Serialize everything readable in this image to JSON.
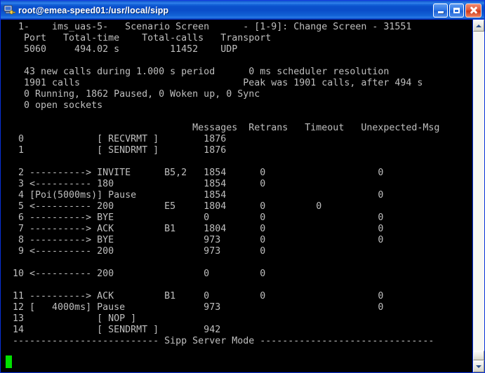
{
  "window": {
    "title": "root@emea-speed01:/usr/local/sipp",
    "icon": "putty-terminal-icon",
    "titlebar_color": "#0a4ec9",
    "buttons": {
      "minimize_label": "_",
      "maximize_label": "□",
      "close_label": "✕"
    }
  },
  "terminal": {
    "foreground_color": "#bfbfbf",
    "background_color": "#000000",
    "cursor_color": "#00e000",
    "lines": [
      " 1-    ims_uas-5-   Scenario Screen      - [1-9]: Change Screen - 31551",
      "  Port   Total-time    Total-calls   Transport",
      "  5060     494.02 s         11452    UDP",
      "",
      "  43 new calls during 1.000 s period      0 ms scheduler resolution",
      "  1901 calls                             Peak was 1901 calls, after 494 s",
      "  0 Running, 1862 Paused, 0 Woken up, 0 Sync",
      "  0 open sockets",
      "",
      "                                Messages  Retrans   Timeout   Unexpected-Msg",
      " 0             [ RECVRMT ]        1876",
      " 1             [ SENDRMT ]        1876",
      "",
      " 2 ----------> INVITE      B5,2   1854      0                    0",
      " 3 <---------- 180                1854      0",
      " 4 [Poi(5000ms)] Pause            1854                           0",
      " 5 <---------- 200         E5     1804      0         0",
      " 6 ----------> BYE                0         0                    0",
      " 7 ----------> ACK         B1     1804      0                    0",
      " 8 ----------> BYE                973       0                    0",
      " 9 <---------- 200                973       0",
      "",
      "10 <---------- 200                0         0",
      "",
      "11 ----------> ACK         B1     0         0                    0",
      "12 [   4000ms] Pause              973                            0",
      "13             [ NOP ]",
      "14             [ SENDRMT ]        942",
      "-------------------------- Sipp Server Mode -------------------------------"
    ]
  },
  "scrollbar": {
    "up_arrow": "scroll-up-arrow",
    "down_arrow": "scroll-down-arrow",
    "thumb_position": "bottom"
  }
}
